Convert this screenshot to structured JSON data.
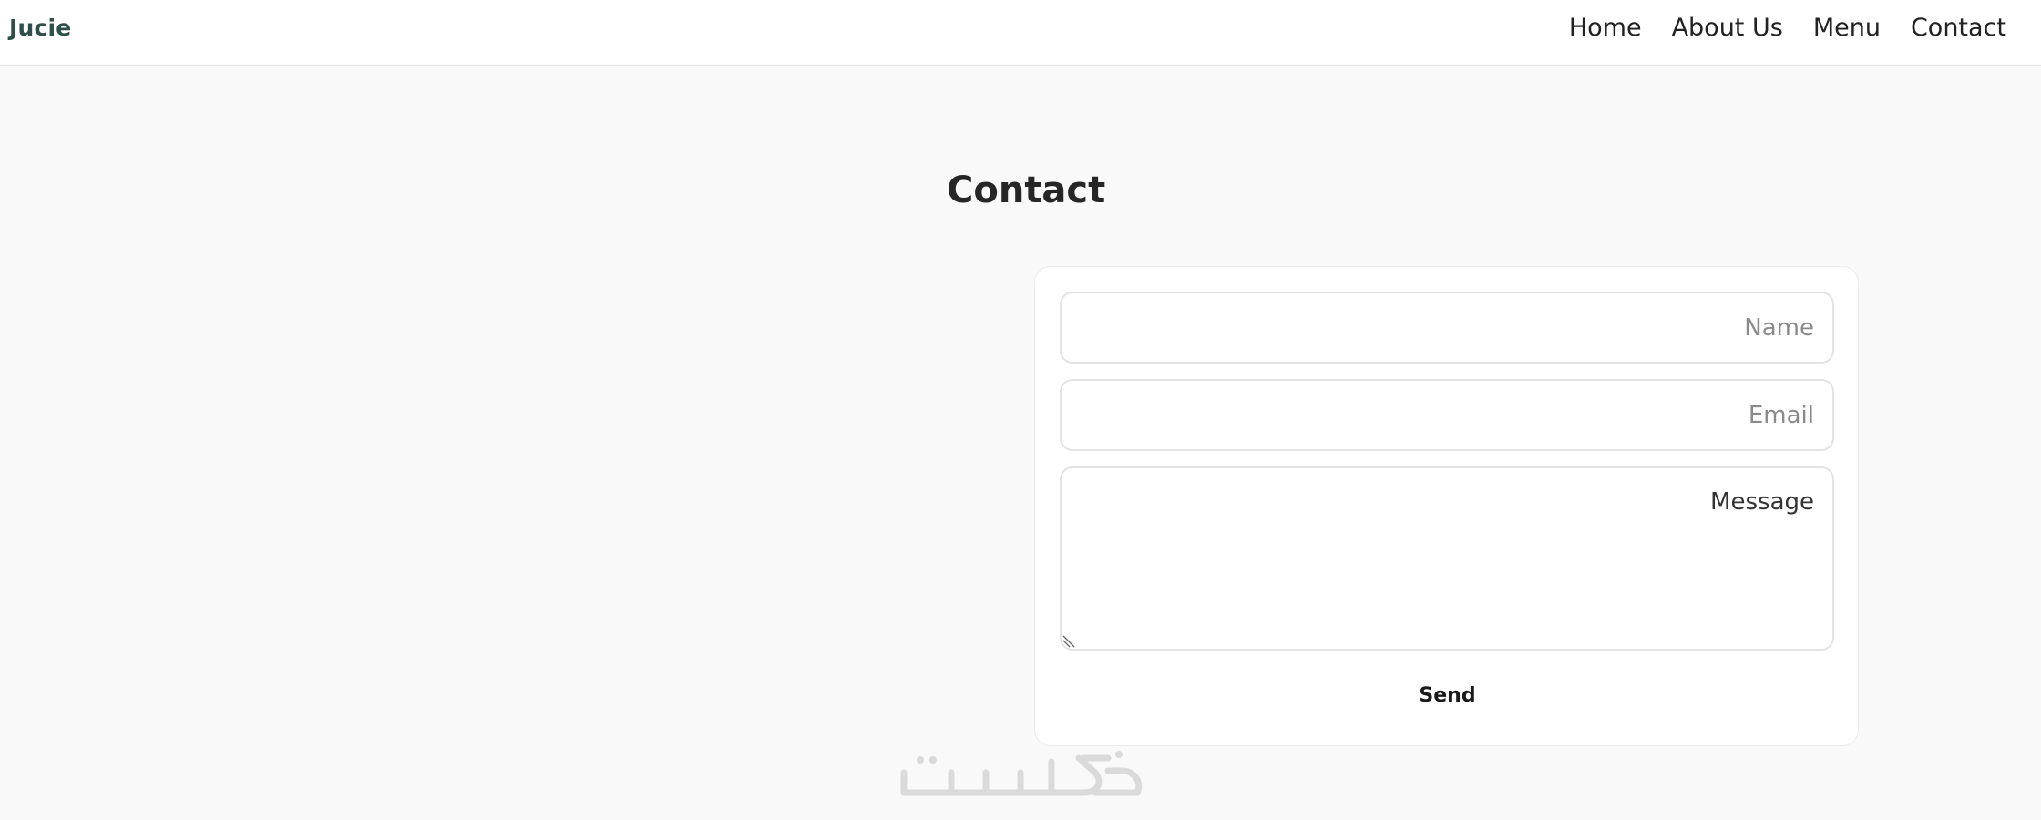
{
  "header": {
    "brand": "Jucie",
    "nav": [
      "Home",
      "About Us",
      "Menu",
      "Contact"
    ]
  },
  "main": {
    "title": "Contact"
  },
  "form": {
    "name_placeholder": "Name",
    "email_placeholder": "Email",
    "message_placeholder": "Message",
    "send_label": "Send"
  },
  "colors": {
    "background": "#f9f9f9",
    "brand": "#2f4f4a",
    "border": "#e3e3e3"
  },
  "icons": {
    "resize": "resize-grip-icon",
    "watermark": "watermark-logo"
  }
}
